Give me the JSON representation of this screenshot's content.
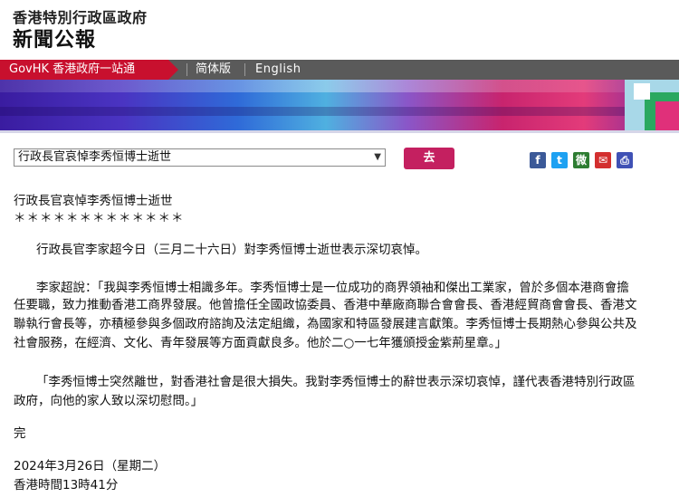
{
  "header": {
    "gov_title": "香港特別行政區政府",
    "section_title": "新聞公報"
  },
  "nav": {
    "govhk": "GovHK 香港政府一站通",
    "simplified": "简体版",
    "english": "English"
  },
  "toolbar": {
    "select_value": "行政長官哀悼李秀恒博士逝世",
    "go_label": "去"
  },
  "share": {
    "facebook_icon": "f",
    "twitter_icon": "t",
    "weibo_icon": "微",
    "mail_icon": "✉",
    "print_icon": "⎙"
  },
  "article": {
    "title": "行政長官哀悼李秀恒博士逝世",
    "stars": "＊＊＊＊＊＊＊＊＊＊＊＊＊",
    "p1": "行政長官李家超今日（三月二十六日）對李秀恒博士逝世表示深切哀悼。",
    "p2_lines": [
      "李家超說：「我與李秀恒博士相識多年。李秀恒博士是一位成功的商界領袖和傑出工業家，曾於多個本港商會擔",
      "任要職，致力推動香港工商界發展。他曾擔任全國政協委員、香港中華廠商聯合會會長、香港經貿商會會長、香港文",
      "聯執行會長等，亦積極參與多個政府諮詢及法定組織，為國家和特區發展建言獻策。李秀恒博士長期熱心參與公共及",
      "社會服務，在經濟、文化、青年發展等方面貢獻良多。他於二○一七年獲頒授金紫荊星章。」"
    ],
    "p3_lines": [
      "「李秀恒博士突然離世，對香港社會是很大損失。我對李秀恒博士的辭世表示深切哀悼，謹代表香港特別行政區",
      "政府，向他的家人致以深切慰問。」"
    ],
    "end": "完",
    "date": "2024年3月26日（星期二）",
    "time": "香港時間13時41分"
  }
}
